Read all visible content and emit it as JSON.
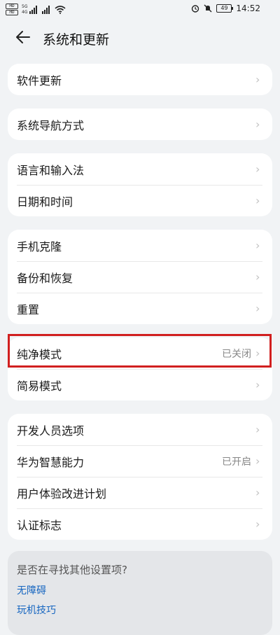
{
  "status_bar": {
    "sim1": "HD",
    "sim2": "HD",
    "net1": "5G",
    "net2": "4G",
    "battery": "49",
    "time": "14:52"
  },
  "header": {
    "title": "系统和更新"
  },
  "groups": [
    {
      "items": [
        {
          "label": "软件更新",
          "value": ""
        }
      ]
    },
    {
      "items": [
        {
          "label": "系统导航方式",
          "value": ""
        }
      ]
    },
    {
      "items": [
        {
          "label": "语言和输入法",
          "value": ""
        },
        {
          "label": "日期和时间",
          "value": ""
        }
      ]
    },
    {
      "items": [
        {
          "label": "手机克隆",
          "value": ""
        },
        {
          "label": "备份和恢复",
          "value": ""
        },
        {
          "label": "重置",
          "value": ""
        }
      ]
    },
    {
      "items": [
        {
          "label": "纯净模式",
          "value": "已关闭"
        },
        {
          "label": "简易模式",
          "value": ""
        }
      ]
    },
    {
      "items": [
        {
          "label": "开发人员选项",
          "value": ""
        },
        {
          "label": "华为智慧能力",
          "value": "已开启"
        },
        {
          "label": "用户体验改进计划",
          "value": ""
        },
        {
          "label": "认证标志",
          "value": ""
        }
      ]
    }
  ],
  "suggestions": {
    "question": "是否在寻找其他设置项?",
    "links": [
      "无障碍",
      "玩机技巧"
    ]
  },
  "colors": {
    "highlight": "#d11f1f",
    "link": "#1565c0"
  }
}
